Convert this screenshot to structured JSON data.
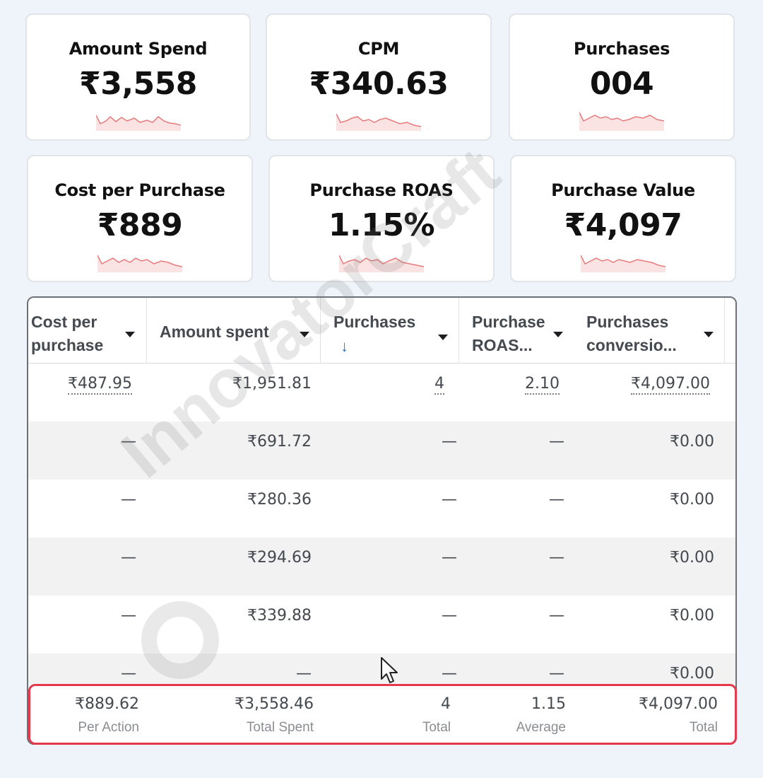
{
  "kpi_cards": [
    {
      "title": "Amount Spend",
      "value": "₹3,558"
    },
    {
      "title": "CPM",
      "value": "₹340.63"
    },
    {
      "title": "Purchases",
      "value": "004"
    },
    {
      "title": "Cost per Purchase",
      "value": "₹889"
    },
    {
      "title": "Purchase ROAS",
      "value": "1.15%"
    },
    {
      "title": "Purchase Value",
      "value": "₹4,097"
    }
  ],
  "table": {
    "columns": [
      {
        "line1": "Cost per",
        "line2": "purchase"
      },
      {
        "line1": "Amount spent",
        "line2": ""
      },
      {
        "line1": "Purchases",
        "line2": "↓"
      },
      {
        "line1": "Purchase",
        "line2": "ROAS..."
      },
      {
        "line1": "Purchases",
        "line2": "conversio..."
      }
    ],
    "rows": [
      [
        "₹487.95",
        "₹1,951.81",
        "4",
        "2.10",
        "₹4,097.00"
      ],
      [
        "—",
        "₹691.72",
        "—",
        "—",
        "₹0.00"
      ],
      [
        "—",
        "₹280.36",
        "—",
        "—",
        "₹0.00"
      ],
      [
        "—",
        "₹294.69",
        "—",
        "—",
        "₹0.00"
      ],
      [
        "—",
        "₹339.88",
        "—",
        "—",
        "₹0.00"
      ],
      [
        "—",
        "—",
        "—",
        "—",
        "₹0.00"
      ]
    ],
    "summary": [
      {
        "value": "₹889.62",
        "label": "Per Action"
      },
      {
        "value": "₹3,558.46",
        "label": "Total Spent"
      },
      {
        "value": "4",
        "label": "Total"
      },
      {
        "value": "1.15",
        "label": "Average"
      },
      {
        "value": "₹4,097.00",
        "label": "Total"
      }
    ]
  },
  "watermark": "InnovatorCraft",
  "colors": {
    "highlight_border": "#e5384a",
    "sort_arrow": "#1a73e8",
    "sparkline": "#e87a7a"
  }
}
